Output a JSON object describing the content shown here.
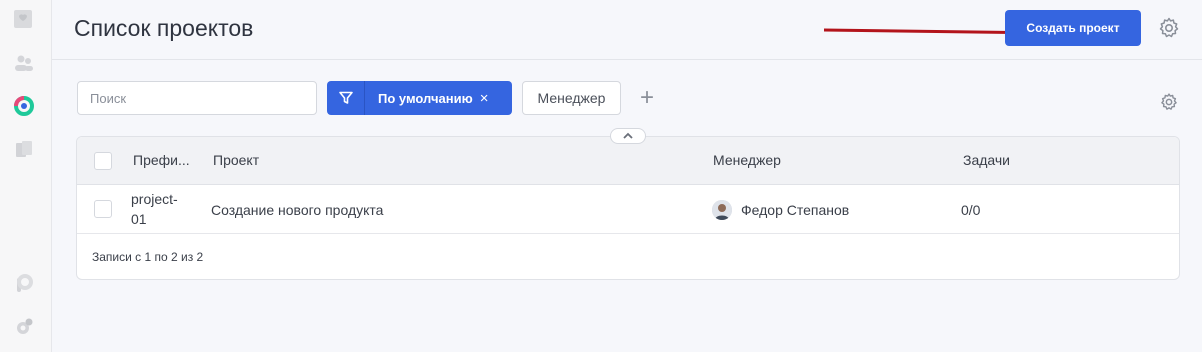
{
  "header": {
    "title": "Список проектов",
    "create_label": "Создать проект"
  },
  "toolbar": {
    "search_placeholder": "Поиск",
    "filter_label": "По умолчанию",
    "filter_clear": "×",
    "manager_label": "Менеджер",
    "add_label": "+"
  },
  "table": {
    "columns": [
      "Префи...",
      "Проект",
      "Менеджер",
      "Задачи"
    ],
    "rows": [
      {
        "prefix_line1": "project-",
        "prefix_line2": "01",
        "project": "Создание нового продукта",
        "manager": "Федор Степанов",
        "tasks": "0/0"
      }
    ],
    "footer": "Записи с 1 по 2 из 2"
  },
  "colors": {
    "accent": "#3565e0",
    "arrow": "#b3141b"
  },
  "icons": {
    "filter": "filter-icon",
    "settings": "gear-icon",
    "collapse": "chevron-up-icon"
  }
}
